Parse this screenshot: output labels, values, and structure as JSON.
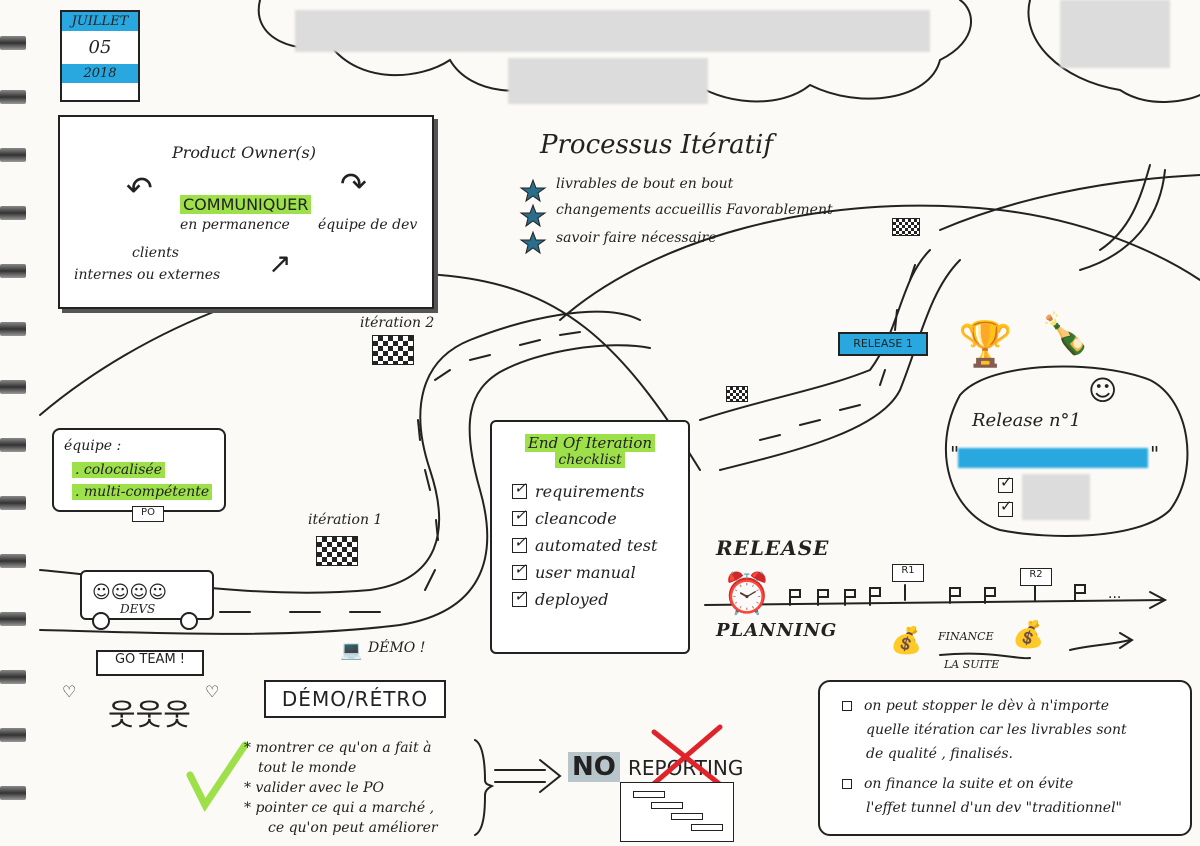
{
  "calendar": {
    "month": "JUILLET",
    "day": "05",
    "year": "2018"
  },
  "communication": {
    "top": "Product Owner(s)",
    "center": "COMMUNIQUER",
    "sub": "en permanence",
    "right": "équipe de dev",
    "bottom1": "clients",
    "bottom2": "internes ou externes"
  },
  "processus": {
    "title": "Processus Itératif",
    "items": [
      "livrables de bout en bout",
      "changements accueillis Favorablement",
      "savoir faire nécessaire"
    ]
  },
  "team": {
    "title": "équipe :",
    "line1": ". colocalisée",
    "line2": ". multi-compétente",
    "po": "PO",
    "devs": "DEVS",
    "go": "GO TEAM !"
  },
  "iterations": {
    "it1": "itération 1",
    "it2": "itération 2"
  },
  "checklist": {
    "title1": "End Of Iteration",
    "title2": "checklist",
    "items": [
      "requirements",
      "cleancode",
      "automated test",
      "user manual",
      "deployed"
    ]
  },
  "release": {
    "banner": "RELEASE 1",
    "title": "Release n°1",
    "quote_open": "\"",
    "quote_close": "\""
  },
  "planning": {
    "release_word": "RELEASE",
    "planning_word": "PLANNING",
    "r1": "R1",
    "r2": "R2",
    "finance": "FINANCE",
    "suite": "LA SUITE",
    "dots": "..."
  },
  "demo": {
    "laptop_label": "DÉMO !",
    "banner": "DÉMO/RÉTRO",
    "bullets": [
      "* montrer ce qu'on a fait à",
      "tout le monde",
      "* valider avec le PO",
      "* pointer ce qui a marché ,",
      "ce qu'on peut améliorer"
    ]
  },
  "reporting": {
    "no": "NO",
    "word": "REPORTING"
  },
  "notes": [
    {
      "line1": "on peut stopper le dèv à n'importe",
      "line2": "quelle itération car les livrables sont",
      "line3": "de qualité , finalisés."
    },
    {
      "line1": "on finance la suite et on évite",
      "line2": "l'effet tunnel d'un dev \"traditionnel\""
    }
  ],
  "colors": {
    "green": "#9de04a",
    "blue": "#29a8e0",
    "ink": "#222222"
  }
}
